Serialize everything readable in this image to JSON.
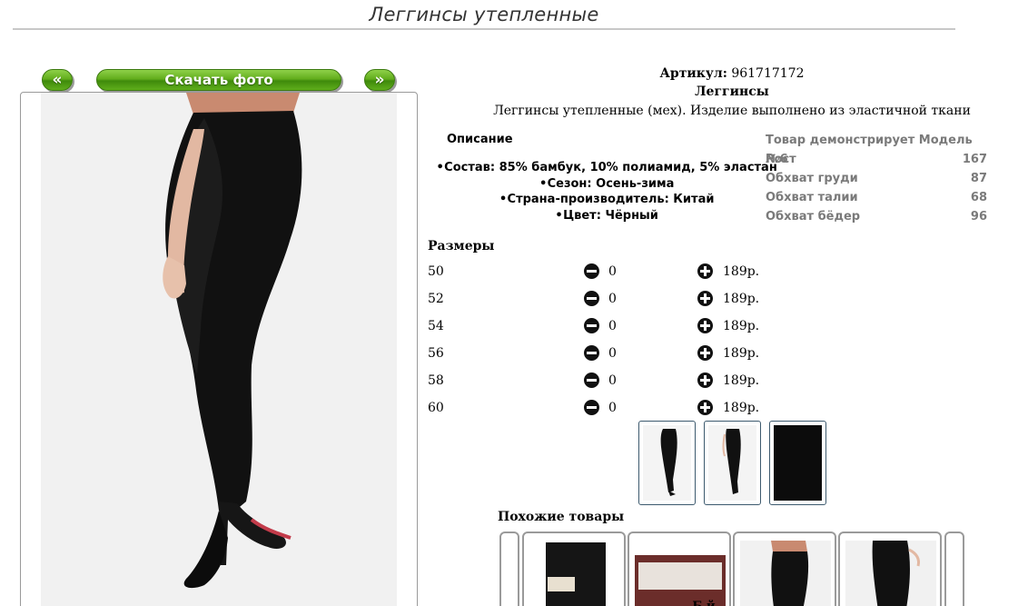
{
  "page": {
    "title": "Леггинсы утепленные"
  },
  "gallery": {
    "prev_label": "«",
    "download_label": "Скачать фото",
    "next_label": "»"
  },
  "product": {
    "article_label": "Артикул:",
    "article_value": "961717172",
    "name": "Леггинсы",
    "description": "Леггинсы утепленные (мех). Изделие выполнено из эластичной ткани"
  },
  "description_section": {
    "heading": "Описание",
    "items": [
      "Состав: 85% бамбук, 10% полиамид, 5% эластан",
      "Сезон: Осень-зима",
      "Страна-производитель: Китай",
      "Цвет: Чёрный"
    ]
  },
  "model_info": {
    "rows": [
      {
        "label": "Товар демонстрирует Модель №6",
        "value": ""
      },
      {
        "label": "Рост",
        "value": "167"
      },
      {
        "label": "Обхват груди",
        "value": "87"
      },
      {
        "label": "Обхват талии",
        "value": "68"
      },
      {
        "label": "Обхват бёдер",
        "value": "96"
      }
    ]
  },
  "sizes": {
    "heading": "Размеры",
    "rows": [
      {
        "size": "50",
        "qty": "0",
        "price": "189р."
      },
      {
        "size": "52",
        "qty": "0",
        "price": "189р."
      },
      {
        "size": "54",
        "qty": "0",
        "price": "189р."
      },
      {
        "size": "56",
        "qty": "0",
        "price": "189р."
      },
      {
        "size": "58",
        "qty": "0",
        "price": "189р."
      },
      {
        "size": "60",
        "qty": "0",
        "price": "189р."
      }
    ]
  },
  "similar": {
    "heading": "Похожие товары",
    "caption_fragment": "Б й"
  },
  "icons": {
    "minus": "minus-circle-icon",
    "plus": "plus-circle-icon"
  },
  "colors": {
    "button_green": "#5fae1b",
    "frame_border": "#9a9a9a",
    "model_text": "#7a7a7a"
  }
}
